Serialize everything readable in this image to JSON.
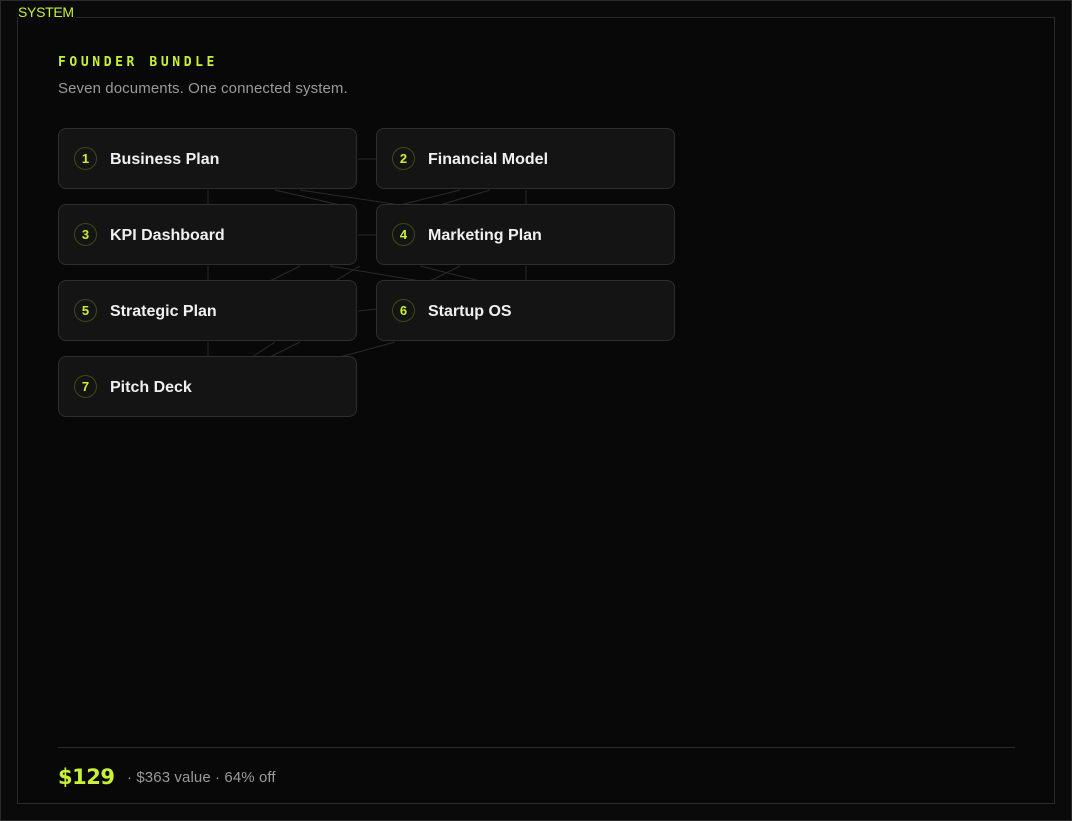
{
  "header": {
    "system_label": "SYSTEM"
  },
  "bundle": {
    "title": "FOUNDER BUNDLE",
    "subtitle": "Seven documents. One connected system."
  },
  "documents": [
    {
      "number": "1",
      "name": "Business Plan"
    },
    {
      "number": "2",
      "name": "Financial Model"
    },
    {
      "number": "3",
      "name": "KPI Dashboard"
    },
    {
      "number": "4",
      "name": "Marketing Plan"
    },
    {
      "number": "5",
      "name": "Strategic Plan"
    },
    {
      "number": "6",
      "name": "Startup OS"
    },
    {
      "number": "7",
      "name": "Pitch Deck"
    }
  ],
  "pricing": {
    "price": "$129",
    "meta": "· $363 value · 64% off"
  },
  "colors": {
    "accent": "#c8f135",
    "background": "#0a0a0a",
    "card": "#141414",
    "muted_text": "#9a9a9a"
  }
}
